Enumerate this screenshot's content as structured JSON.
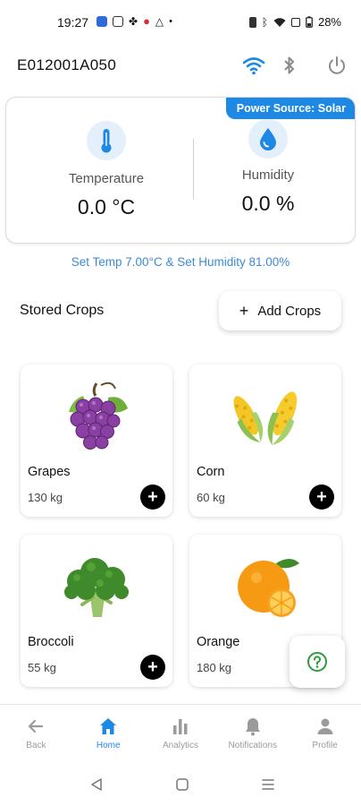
{
  "status_bar": {
    "time": "19:27",
    "battery": "28%",
    "dot": "•"
  },
  "header": {
    "device_id": "E012001A050",
    "icons": [
      "wifi-icon",
      "bluetooth-icon",
      "power-icon"
    ]
  },
  "sensor_card": {
    "power_source": "Power Source: Solar",
    "temperature": {
      "label": "Temperature",
      "value": "0.0 °C",
      "icon": "thermometer-icon"
    },
    "humidity": {
      "label": "Humidity",
      "value": "0.0 %",
      "icon": "water-drop-icon"
    }
  },
  "setpoint_text": "Set Temp 7.00°C & Set Humidity 81.00%",
  "stored_crops": {
    "title": "Stored Crops",
    "add_button": {
      "plus": "+",
      "label": "Add Crops"
    },
    "crops": [
      {
        "name": "Grapes",
        "qty": "130 kg",
        "icon": "grapes-icon"
      },
      {
        "name": "Corn",
        "qty": "60 kg",
        "icon": "corn-icon"
      },
      {
        "name": "Broccoli",
        "qty": "55 kg",
        "icon": "broccoli-icon"
      },
      {
        "name": "Orange",
        "qty": "180 kg",
        "icon": "orange-icon"
      }
    ],
    "card_add_symbol": "+"
  },
  "help_icon": "help-icon",
  "bottom_nav": [
    {
      "label": "Back",
      "icon": "back-arrow-icon",
      "active": false
    },
    {
      "label": "Home",
      "icon": "home-icon",
      "active": true
    },
    {
      "label": "Analytics",
      "icon": "bar-chart-icon",
      "active": false
    },
    {
      "label": "Notifications",
      "icon": "bell-icon",
      "active": false
    },
    {
      "label": "Profile",
      "icon": "person-icon",
      "active": false
    }
  ],
  "colors": {
    "accent": "#1e88e5",
    "setpoint_text": "#3b8ad8",
    "help_green": "#2e9b3a",
    "nav_inactive": "#9b9b9b"
  }
}
